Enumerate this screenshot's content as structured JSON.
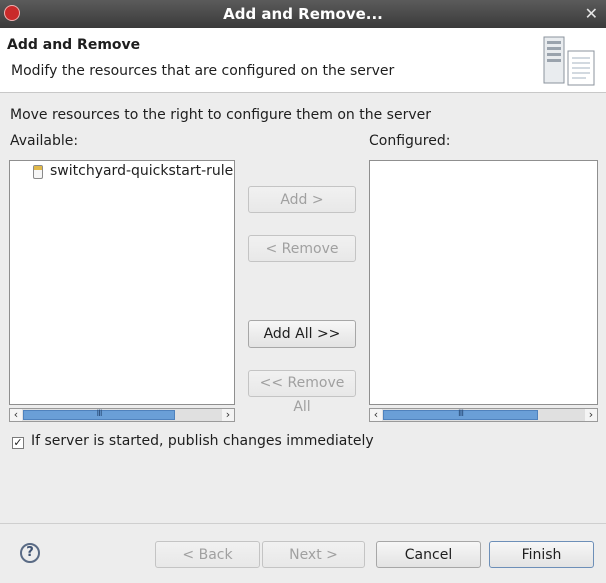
{
  "window": {
    "title": "Add and Remove...",
    "close_glyph": "✕"
  },
  "header": {
    "title": "Add and Remove",
    "description": "Modify the resources that are configured on the server",
    "icon": "server-config-icon"
  },
  "instructions": "Move resources to the right to configure them on the server",
  "available": {
    "label": "Available:",
    "items": [
      "switchyard-quickstart-rules-"
    ]
  },
  "configured": {
    "label": "Configured:",
    "items": []
  },
  "buttons": {
    "add": "Add >",
    "remove": "< Remove",
    "add_all": "Add All >>",
    "remove_all": "<< Remove All"
  },
  "publish_checkbox": {
    "label": "If server is started, publish changes immediately",
    "checked": true
  },
  "footer": {
    "help": "?",
    "back": "< Back",
    "next": "Next >",
    "cancel": "Cancel",
    "finish": "Finish"
  },
  "scroll_glyphs": {
    "left": "‹",
    "right": "›",
    "grip": "III"
  }
}
